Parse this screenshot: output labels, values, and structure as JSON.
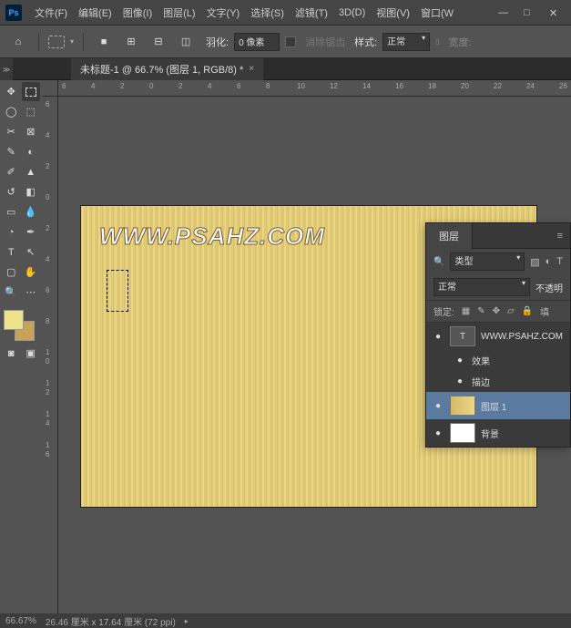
{
  "app": {
    "logo": "Ps"
  },
  "menu": [
    "文件(F)",
    "编辑(E)",
    "图像(I)",
    "图层(L)",
    "文字(Y)",
    "选择(S)",
    "滤镜(T)",
    "3D(D)",
    "视图(V)",
    "窗口(W"
  ],
  "options": {
    "feather_label": "羽化:",
    "feather_value": "0 像素",
    "antialias": "消除锯齿",
    "style_label": "样式:",
    "style_value": "正常",
    "width_label": "宽度:"
  },
  "tab": {
    "title": "未标题-1 @ 66.7% (图层 1, RGB/8) *"
  },
  "ruler_h": [
    "6",
    "4",
    "2",
    "0",
    "2",
    "4",
    "6",
    "8",
    "10",
    "12",
    "14",
    "16",
    "18",
    "20",
    "22",
    "24",
    "26"
  ],
  "ruler_v": [
    "6",
    "4",
    "2",
    "0",
    "2",
    "4",
    "6",
    "8",
    "1",
    "0",
    "1",
    "2",
    "1",
    "4",
    "1",
    "6"
  ],
  "canvas": {
    "text": "WWW.PSAHZ.COM"
  },
  "layers": {
    "tab": "图层",
    "filter": "类型",
    "blend": "正常",
    "opacity_label": "不透明",
    "lock_label": "锁定:",
    "fill_label": "填",
    "items": [
      {
        "eye": "●",
        "type": "T",
        "name": "WWW.PSAHZ.COM"
      },
      {
        "eye": "●",
        "type": "fx",
        "name": "效果"
      },
      {
        "eye": "●",
        "type": "fx",
        "name": "描边"
      },
      {
        "eye": "●",
        "type": "gold",
        "name": "图层 1",
        "selected": true
      },
      {
        "eye": "●",
        "type": "white",
        "name": "背景"
      }
    ]
  },
  "status": {
    "zoom": "66.67%",
    "dims": "26.46 厘米 x 17.64 厘米 (72 ppi)"
  }
}
